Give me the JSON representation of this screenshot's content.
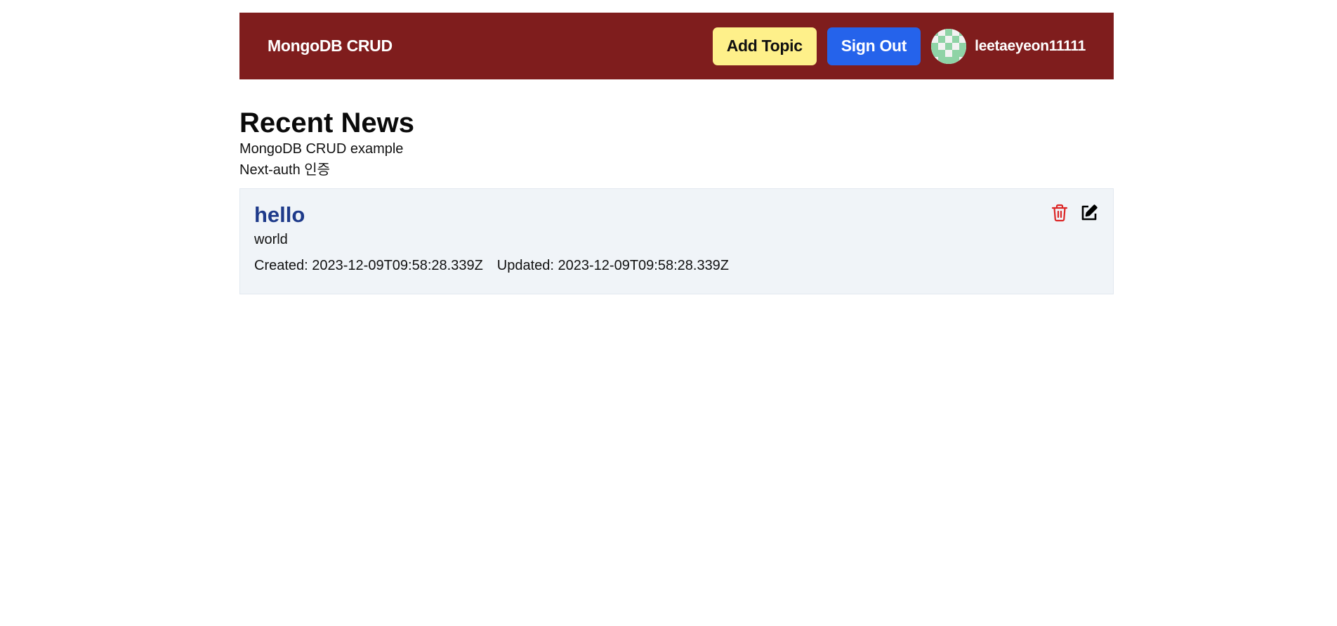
{
  "navbar": {
    "brand": "MongoDB CRUD",
    "add_topic_label": "Add Topic",
    "sign_out_label": "Sign Out",
    "username": "leetaeyeon11111",
    "brand_color": "#7f1d1d",
    "add_button_color": "#fef08a",
    "sign_out_color": "#2563eb"
  },
  "page": {
    "title": "Recent News",
    "subtitles": [
      "MongoDB CRUD example",
      "Next-auth 인증"
    ]
  },
  "topics": [
    {
      "title": "hello",
      "description": "world",
      "created": "Created: 2023-12-09T09:58:28.339Z",
      "updated": "Updated: 2023-12-09T09:58:28.339Z",
      "delete_icon": "trash-icon",
      "edit_icon": "edit-icon"
    }
  ]
}
